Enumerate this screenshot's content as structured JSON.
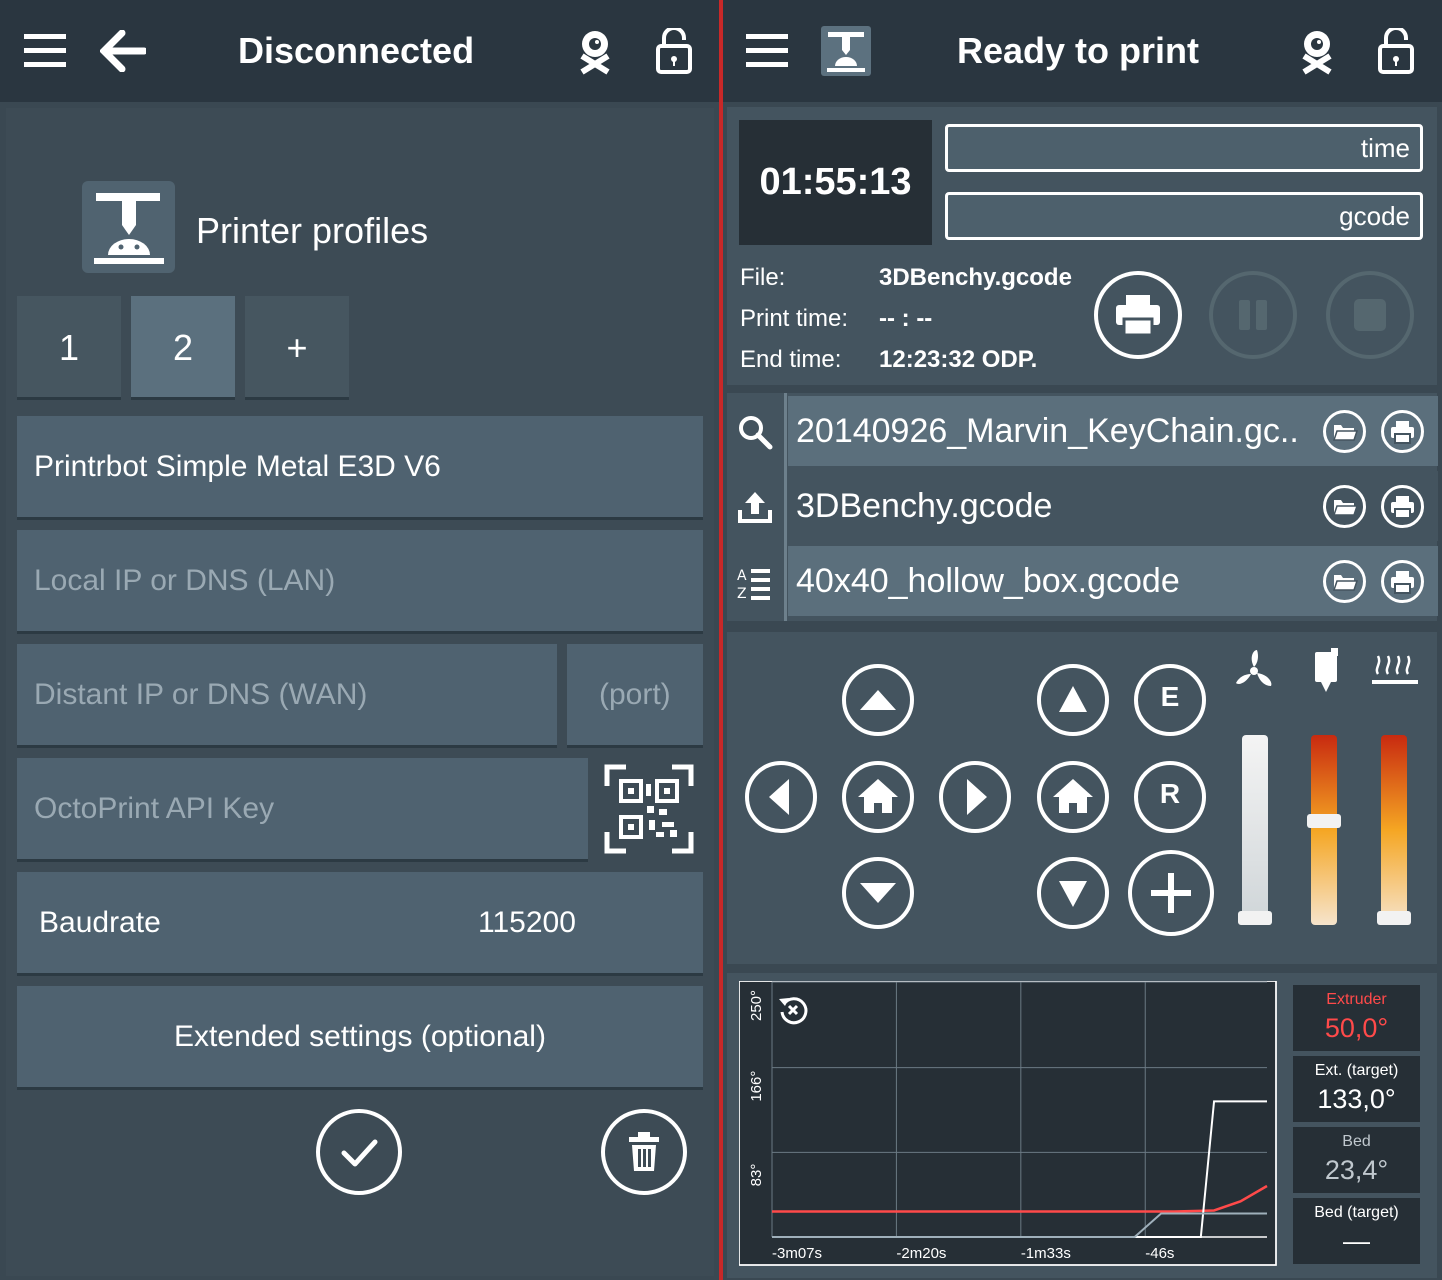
{
  "left": {
    "header_title": "Disconnected",
    "section_title": "Printer profiles",
    "profile_tabs": [
      "1",
      "2",
      "+"
    ],
    "active_tab_index": 1,
    "profile_name": "Printrbot Simple Metal E3D V6",
    "local_ip_placeholder": "Local IP or DNS (LAN)",
    "distant_ip_placeholder": "Distant IP or DNS (WAN)",
    "port_placeholder": "(port)",
    "api_key_placeholder": "OctoPrint API Key",
    "baudrate_label": "Baudrate",
    "baudrate_value": "115200",
    "extended_settings_label": "Extended settings (optional)"
  },
  "right": {
    "header_title": "Ready to print",
    "clock": "01:55:13",
    "time_box": "time",
    "gcode_box": "gcode",
    "file_label": "File:",
    "file_value": "3DBenchy.gcode",
    "print_time_label": "Print time:",
    "print_time_value": "-- : --",
    "end_time_label": "End time:",
    "end_time_value": "12:23:32 ODP.",
    "files": [
      {
        "name": "20140926_Marvin_KeyChain.gc..",
        "highlight": true
      },
      {
        "name": "3DBenchy.gcode",
        "highlight": false
      },
      {
        "name": "40x40_hollow_box.gcode",
        "highlight": true
      }
    ],
    "jog_labels": {
      "extrude": "E",
      "retract": "R"
    },
    "sliders": {
      "fan": 0.0,
      "extruder": 0.55,
      "bed": 0.0
    },
    "temperatures": [
      {
        "label": "Extruder",
        "value": "50,0°",
        "color": "#ff4a4a"
      },
      {
        "label": "Ext. (target)",
        "value": "133,0°",
        "color": "#ffffff"
      },
      {
        "label": "Bed",
        "value": "23,4°",
        "color": "#c0c8ce"
      },
      {
        "label": "Bed (target)",
        "value": "—",
        "color": "#ffffff"
      }
    ]
  },
  "chart_data": {
    "type": "line",
    "x_tick_labels": [
      "-3m07s",
      "-2m20s",
      "-1m33s",
      "-46s"
    ],
    "y_tick_labels": [
      "83°",
      "166°",
      "250°"
    ],
    "ylim": [
      0,
      250
    ],
    "grid": true,
    "series": [
      {
        "name": "Extruder",
        "color": "#ff4a4a",
        "x": [
          -187,
          -40,
          -35,
          -20,
          -10,
          0
        ],
        "y": [
          25,
          25,
          25,
          26,
          35,
          50
        ]
      },
      {
        "name": "Ext. (target)",
        "color": "#ffffff",
        "x": [
          -187,
          -25,
          -20,
          0
        ],
        "y": [
          0,
          0,
          133,
          133
        ]
      },
      {
        "name": "Bed",
        "color": "#9fb0bb",
        "x": [
          -187,
          -50,
          -40,
          0
        ],
        "y": [
          0,
          0,
          23,
          23
        ]
      }
    ]
  }
}
